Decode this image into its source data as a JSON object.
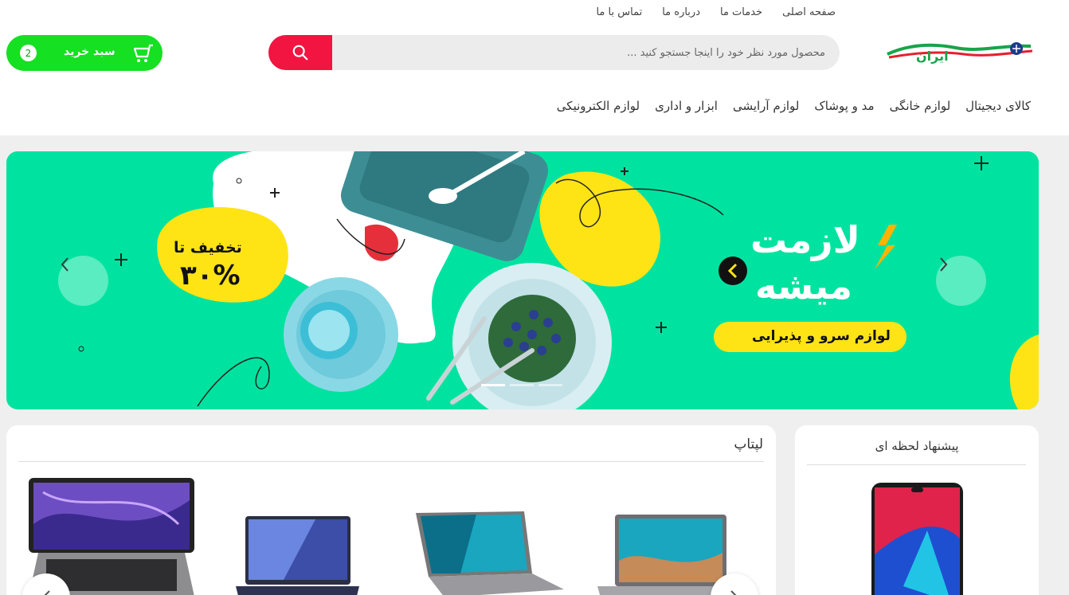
{
  "top_links": [
    "صفحه اصلی",
    "خدمات ما",
    "درباره ما",
    "تماس با ما"
  ],
  "search": {
    "placeholder": "محصول مورد نظر خود را اینجا جستجو کنید ..."
  },
  "cart": {
    "label": "سبد خرید",
    "count": "2"
  },
  "categories": [
    "کالای دیجیتال",
    "لوازم خانگی",
    "مد و پوشاک",
    "لوازم آرایشی",
    "ابزار و اداری",
    "لوازم الکترونیکی"
  ],
  "banner": {
    "discount_line1": "تخفیف تا",
    "discount_line2": "۳۰%",
    "headline_line1": "لازمت",
    "headline_line2": "میشه",
    "subtitle": "لوازم سرو و پذیرایی",
    "slide_count": 3,
    "active_slide": 0
  },
  "laptop_section": {
    "title": "لپتاپ"
  },
  "offer_section": {
    "title": "پیشنهاد لحظه ای"
  },
  "colors": {
    "accent_red": "#f21441",
    "cart_green": "#15e021",
    "banner_green": "#00e3a0",
    "banner_yellow": "#ffe415"
  }
}
